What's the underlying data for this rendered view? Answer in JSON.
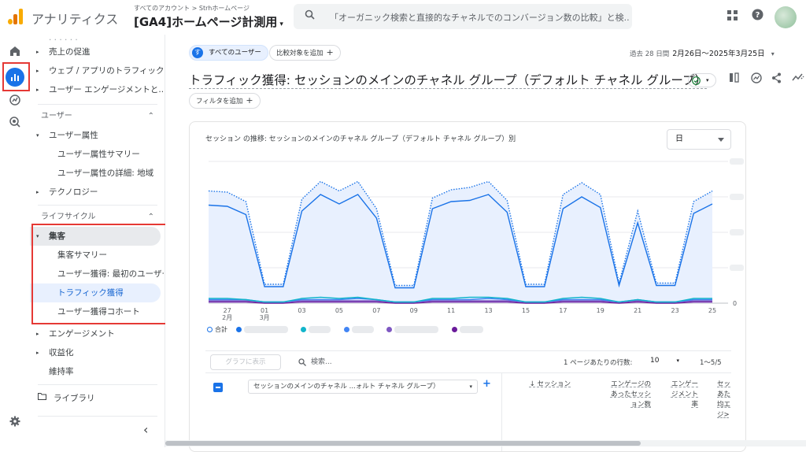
{
  "app": {
    "name": "アナリティクス",
    "account_path": "すべてのアカウント > Strhホームページ",
    "property": "[GA4]ホームページ計測用"
  },
  "search": {
    "text": "「オーガニック検索と直接的なチャネルでのコンバージョン数の比較」と検..."
  },
  "icons": {
    "apps": "apps-grid-icon",
    "help": "help-icon",
    "search": "search-icon"
  },
  "nav": {
    "items": [
      {
        "label": "売上の促進",
        "arrow": "▸"
      },
      {
        "label": "ウェブ / アプリのトラフィック...",
        "arrow": "▸"
      },
      {
        "label": "ユーザー エンゲージメントと...",
        "arrow": "▸"
      }
    ],
    "user_section": "ユーザー",
    "user_attr": "ユーザー属性",
    "user_attr_summary": "ユーザー属性サマリー",
    "user_attr_detail": "ユーザー属性の詳細: 地域",
    "technology": "テクノロジー",
    "lifecycle_section": "ライフサイクル",
    "acquisition": "集客",
    "acq_summary": "集客サマリー",
    "user_acq": "ユーザー獲得: 最初のユーザー...",
    "traffic_acq": "トラフィック獲得",
    "user_cohort": "ユーザー獲得コホート",
    "engagement": "エンゲージメント",
    "monetization": "収益化",
    "retention": "維持率",
    "library": "ライブラリ",
    "collapse": "‹"
  },
  "toolbar": {
    "all_users": "すべてのユーザー",
    "user_initial": "す",
    "add_compare": "比較対象を追加",
    "add_filter": "フィルタを追加",
    "date_prefix": "過去 28 日間",
    "date_range": "2月26日～2025年3月25日"
  },
  "page": {
    "title": "トラフィック獲得: セッションのメインのチャネル グループ（デフォルト チャネル グループ）"
  },
  "card": {
    "title": "セッション の推移: セッションのメインのチャネル グループ（デフォルト チャネル グループ）別",
    "granularity": "日",
    "legend_total": "合計"
  },
  "chart_data": {
    "type": "line",
    "x": [
      "2月26日",
      "2月27日",
      "2月28日",
      "3月1日",
      "3月2日",
      "3月3日",
      "3月4日",
      "3月5日",
      "3月6日",
      "3月7日",
      "3月8日",
      "3月9日",
      "3月10日",
      "3月11日",
      "3月12日",
      "3月13日",
      "3月14日",
      "3月15日",
      "3月16日",
      "3月17日",
      "3月18日",
      "3月19日",
      "3月20日",
      "3月21日",
      "3月22日",
      "3月23日",
      "3月24日",
      "3月25日"
    ],
    "x_tick_labels": [
      "27\n2月",
      "01\n3月",
      "03",
      "05",
      "07",
      "09",
      "11",
      "13",
      "15",
      "17",
      "19",
      "21",
      "23",
      "25"
    ],
    "y_tick_labels": [
      "0"
    ],
    "series": [
      {
        "name": "合計",
        "color": "#1a73e8",
        "style": "dotted",
        "values": [
          95,
          94,
          86,
          16,
          16,
          88,
          103,
          95,
          103,
          80,
          15,
          15,
          89,
          96,
          98,
          103,
          87,
          16,
          16,
          92,
          102,
          92,
          17,
          78,
          17,
          17,
          86,
          95
        ]
      },
      {
        "color": "#1a73e8",
        "values": [
          83,
          82,
          75,
          14,
          14,
          78,
          92,
          84,
          92,
          72,
          13,
          13,
          80,
          86,
          87,
          92,
          77,
          14,
          14,
          80,
          90,
          81,
          15,
          68,
          15,
          15,
          76,
          84
        ]
      },
      {
        "color": "#12b5cb",
        "values": [
          4,
          4,
          3,
          1,
          1,
          4,
          5,
          4,
          5,
          3,
          1,
          1,
          4,
          4,
          5,
          5,
          4,
          1,
          1,
          4,
          5,
          4,
          1,
          3,
          1,
          1,
          4,
          4
        ]
      },
      {
        "color": "#4285f4",
        "values": [
          3,
          3,
          3,
          1,
          1,
          3,
          3,
          3,
          4,
          3,
          1,
          1,
          3,
          3,
          3,
          4,
          3,
          1,
          1,
          3,
          3,
          3,
          1,
          3,
          1,
          1,
          3,
          3
        ]
      },
      {
        "color": "#7e57c2",
        "values": [
          2,
          2,
          2,
          1,
          1,
          2,
          2,
          2,
          2,
          2,
          1,
          1,
          2,
          2,
          2,
          2,
          2,
          1,
          1,
          2,
          2,
          2,
          1,
          2,
          1,
          1,
          2,
          2
        ]
      },
      {
        "color": "#6a1b9a",
        "values": [
          1,
          1,
          1,
          0,
          0,
          1,
          1,
          1,
          1,
          1,
          0,
          0,
          1,
          1,
          1,
          1,
          1,
          0,
          0,
          1,
          1,
          1,
          0,
          1,
          0,
          0,
          1,
          1
        ]
      }
    ]
  },
  "table": {
    "show_chart": "グラフに表示",
    "search_placeholder": "検索...",
    "rows_label": "1 ページあたりの行数:",
    "rows_value": "10",
    "pager": "1～5/5",
    "dimension": "セッションのメインのチャネル ...ォルト チャネル グループ）",
    "col_sessions": "↓ セッション",
    "col_engaged_1": "エンゲージの",
    "col_engaged_2": "あったセッシ",
    "col_engaged_3": "ョン数",
    "col_rate_1": "エンゲー",
    "col_rate_2": "ジメント",
    "col_rate_3": "率",
    "col_avg_1": "セッ",
    "col_avg_2": "あた",
    "col_avg_3": "均エ",
    "col_avg_4": "ジ>"
  }
}
